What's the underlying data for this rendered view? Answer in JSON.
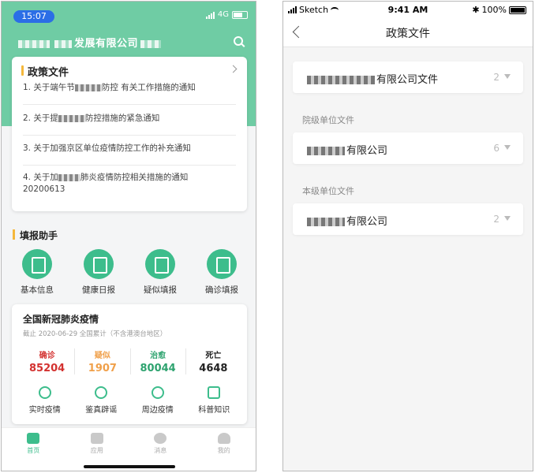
{
  "phone1": {
    "status": {
      "time": "15:07",
      "network": "4G"
    },
    "org_name": "发展有限公司",
    "policy": {
      "title": "政策文件",
      "items": [
        {
          "prefix": "1. 关于端午节",
          "suffix": "防控 有关工作措施的通知"
        },
        {
          "prefix": "2. 关于提",
          "suffix": "防控措施的紧急通知"
        },
        {
          "prefix": "3. 关于加强京区单位疫情防控工作的补充通知",
          "suffix": ""
        },
        {
          "prefix": "4. 关于加",
          "suffix": "肺炎疫情防控相关措施的通知",
          "line2": "20200613"
        }
      ]
    },
    "helper": {
      "title": "填报助手",
      "items": [
        "基本信息",
        "健康日报",
        "疑似填报",
        "确诊填报"
      ]
    },
    "epidemic": {
      "title": "全国新冠肺炎疫情",
      "subtitle": "截止 2020-06-29 全国累计（不含港澳台地区）",
      "stats": [
        {
          "label": "确诊",
          "value": "85204",
          "color": "#d3312f"
        },
        {
          "label": "疑似",
          "value": "1907",
          "color": "#f0a04a"
        },
        {
          "label": "治愈",
          "value": "80044",
          "color": "#2ea36f"
        },
        {
          "label": "死亡",
          "value": "4648",
          "color": "#222222"
        }
      ],
      "tools": [
        "实时疫情",
        "鉴真辟谣",
        "周边疫情",
        "科普知识"
      ]
    },
    "tabs": [
      "首页",
      "应用",
      "消息",
      "我的"
    ]
  },
  "phone2": {
    "status": {
      "carrier": "Sketch",
      "time": "9:41 AM",
      "battery": "100%"
    },
    "nav_title": "政策文件",
    "rows": [
      {
        "group": "",
        "text": "有限公司文件",
        "count": "2"
      },
      {
        "group": "院级单位文件",
        "text": "有限公司",
        "count": "6"
      },
      {
        "group": "本级单位文件",
        "text": "有限公司",
        "count": "2"
      }
    ]
  }
}
